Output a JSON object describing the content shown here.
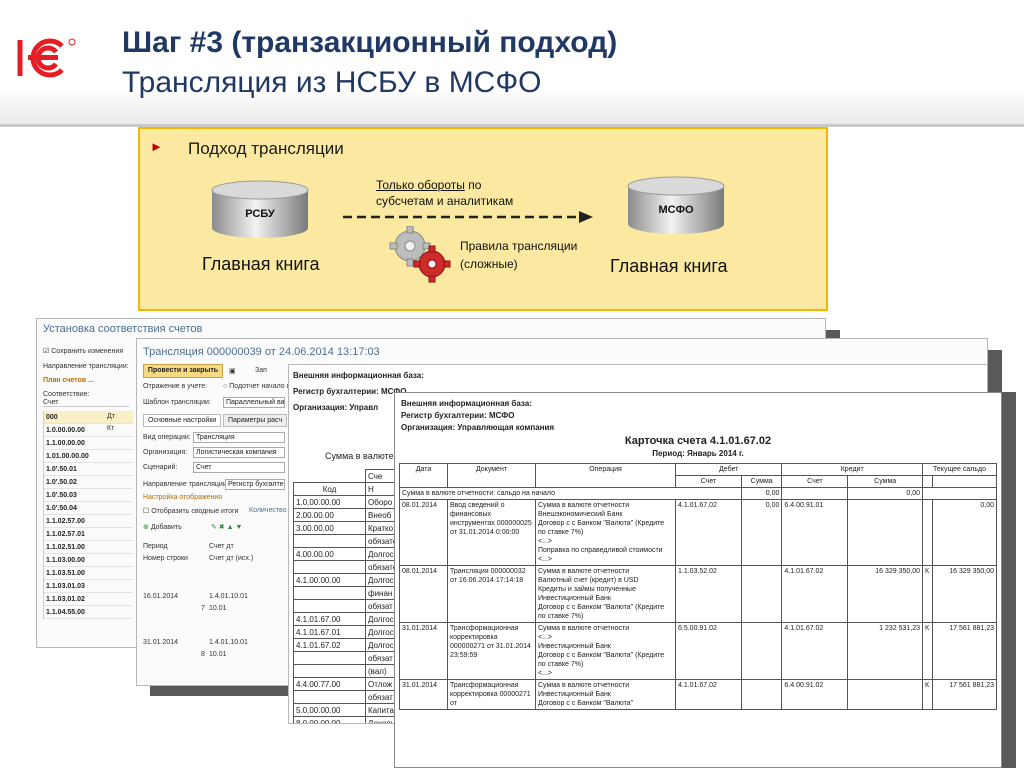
{
  "header": {
    "title_line1": "Шаг #3 (транзакционный подход)",
    "title_line2": "Трансляция из НСБУ в МСФО",
    "logo_text": "1С"
  },
  "colors": {
    "title": "#1f3864",
    "box_fill": "#fbe9a1",
    "box_border": "#f5b800",
    "logo_red": "#e31e24",
    "bullet": "#c00000"
  },
  "scheme": {
    "bullet_text": "Подход трансляции",
    "left_db": "РСБУ",
    "right_db": "МСФО",
    "left_book": "Главная книга",
    "right_book": "Главная книга",
    "only_turnovers_link": "Только обороты",
    "only_turnovers_rest": " по",
    "only_turnovers_line2": "субсчетам и аналитикам",
    "rules_line1": "Правила трансляции",
    "rules_line2": "(сложные)"
  },
  "window_settings": {
    "title": "Установка соответствия счетов",
    "save_changes": "Сохранить изменения",
    "direction_label": "Направление трансляции:",
    "plan_label": "План счетов",
    "setup_label": "Настрой",
    "correspondence_label": "Соответствие:",
    "col_account": "Счет",
    "col_dt": "Дт",
    "col_kt": "Кт",
    "accounts": [
      "000",
      "1.0.00.00.00",
      "1.1.00.00.00",
      "1.01.00.00.00",
      "1.0'.50.01",
      "1.0'.50.02",
      "1.0'.50.03",
      "1.0'.50.04",
      "1.1.02.57.00",
      "1.1.02.57.01",
      "1.1.02.51.00",
      "1.1.03.00.00",
      "1.1.03.51.00",
      "1.1.03.01.03",
      "1.1.03.01.02",
      "1.1.04.55.00"
    ]
  },
  "window_translation": {
    "title": "Трансляция 000000039 от 24.06.2014 13:17:03",
    "post_close": "Провести и закрыть",
    "zap": "Зап",
    "reflect_label": "Отражение в учете:",
    "reflect_value": "Подотчет начало г",
    "template_label": "Шаблон трансляции:",
    "template_value": "Параллельный вариант",
    "tab_main": "Основные настройки",
    "tab_params": "Параметры расч",
    "op_type_label": "Вид операции:",
    "op_type_value": "Трансляция",
    "org_label": "Организация:",
    "org_value": "Логистическая компания",
    "scenario_label": "Сценарий:",
    "scenario_value": "Счет",
    "direction_label": "Направление трансляции:",
    "direction_value": "Регистр бухгалтер...",
    "display_settings": "Настройка отображения",
    "show_summary": "Отобразить сводные итоги",
    "quantity": "Количество",
    "add_button": "Добавить",
    "col_period": "Период",
    "col_account": "Счет дт",
    "col_row_number": "Номер строки",
    "col_account_dt": "Счет дт (исх.)",
    "rows": [
      {
        "period": "16.01.2014",
        "account": "1.4.01.10.01",
        "n": "7",
        "dt": "10.01"
      },
      {
        "period": "31.01.2014",
        "account": "1.4.01.10.01",
        "n": "8",
        "dt": "10.01"
      }
    ]
  },
  "window_ledger": {
    "ext_base": "Внешняя информационная база:",
    "register": "Регистр бухгалтерии: МСФО",
    "org": "Организация: Управл",
    "sum_caption": "Сумма в валюте отчет",
    "col_account_header": "Сче",
    "col_code": "Код",
    "col_name": "Н",
    "rows": [
      {
        "code": "1.0.00.00.00",
        "name": "Оборо"
      },
      {
        "code": "2.00.00.00",
        "name": "Внеоб"
      },
      {
        "code": "3.00.00.00",
        "name": "Кратко"
      },
      {
        "code": "",
        "name": "обязате"
      },
      {
        "code": "4.00.00.00",
        "name": "Долгос"
      },
      {
        "code": "",
        "name": "обязате"
      },
      {
        "code": "4.1.00.00.00",
        "name": "Долгос"
      },
      {
        "code": "",
        "name": "финан"
      },
      {
        "code": "",
        "name": "обязат"
      },
      {
        "code": "4.1.01.67.00",
        "name": "Долгос"
      },
      {
        "code": "4.1.01.67.01",
        "name": "Долгос"
      },
      {
        "code": "4.1.01.67.02",
        "name": "Долгос"
      },
      {
        "code": "",
        "name": "обязат"
      },
      {
        "code": "",
        "name": "(вал)"
      },
      {
        "code": "4.4.00.77.00",
        "name": "Отлож"
      },
      {
        "code": "",
        "name": "обязат"
      },
      {
        "code": "5.0.00.00.00",
        "name": "Капита"
      },
      {
        "code": "8.0.00.00.00",
        "name": "Доходы"
      }
    ]
  },
  "window_card": {
    "ext_base": "Внешняя информационная база:",
    "register": "Регистр бухгалтерии: МСФО",
    "org": "Организация: Управляющая компания",
    "title": "Карточка счета 4.1.01.67.02",
    "period": "Период: Январь 2014 г.",
    "headers": {
      "date": "Дата",
      "document": "Документ",
      "operation": "Операция",
      "debit": "Дебет",
      "credit": "Кредит",
      "balance": "Текущее сальдо",
      "account": "Счет",
      "amount": "Сумма"
    },
    "opening_row": "Сумма в валюте отчетности: сальдо на начало",
    "opening_debit": "0,00",
    "opening_credit": "0,00",
    "rows": [
      {
        "date": "08.01.2014",
        "document": "Ввод сведений о финансовых инструментах 000000025 от 31.01.2014 0:00:00",
        "operation": "Сумма в валюте отчетности\nВнешэкономический Банк\nДоговор с с Банком \"Валюта\" (Кредите по ставке 7%)\n<...>\nПоправка по справедливой стоимости\n<...>",
        "dt_acc": "4.1.01.67.02",
        "dt_sum": "0,00",
        "kt_acc": "6.4.00.91.01",
        "kt_sum": "",
        "bal_sign": "",
        "bal": "0,00"
      },
      {
        "date": "08.01.2014",
        "document": "Трансляция 000000032 от 16.06.2014 17:14:18",
        "operation": "Сумма в валюте отчетности\nВалютный счет (кредит) в USD\nКредиты и займы полученные\nИнвестиционный Банк\nДоговор с с Банком \"Валюта\" (Кредите по ставке 7%)",
        "dt_acc": "1.1.03.52.02",
        "dt_sum": "",
        "kt_acc": "4.1.01.67.02",
        "kt_sum": "16 329 350,00",
        "bal_sign": "К",
        "bal": "16 329 350,00"
      },
      {
        "date": "31.01.2014",
        "document": "Трансформационная корректировка 000000271 от 31.01.2014 23:59:59",
        "operation": "Сумма в валюте отчетности\n<...>\nИнвестиционный Банк\nДоговор с с Банком \"Валюта\" (Кредите по ставке 7%)\n<...>",
        "dt_acc": "6.5.00.91.02",
        "dt_sum": "",
        "kt_acc": "4.1.01.67.02",
        "kt_sum": "1 232 531,23",
        "bal_sign": "К",
        "bal": "17 561 881,23"
      },
      {
        "date": "31.01.2014",
        "document": "Трансформационная корректировка 00000271 от",
        "operation": "Сумма в валюте отчетности\nИнвестиционный Банк\nДоговор с с Банком \"Валюта\"",
        "dt_acc": "4.1.01.67.02",
        "dt_sum": "",
        "kt_acc": "6.4.00.91.02",
        "kt_sum": "",
        "bal_sign": "К",
        "bal": "17 561 881,23"
      }
    ]
  }
}
